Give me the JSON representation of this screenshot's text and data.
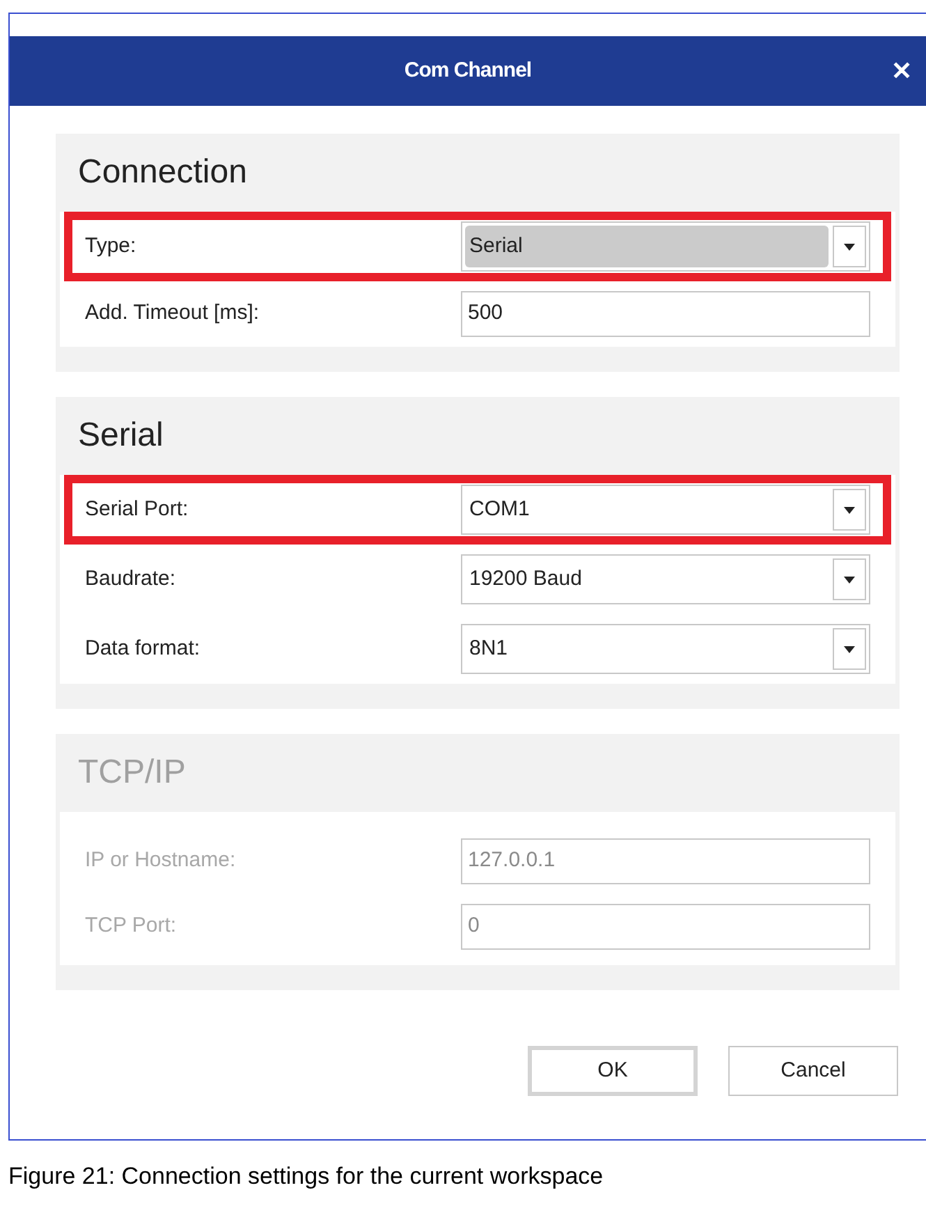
{
  "window": {
    "title": "Com Channel",
    "close": "✕"
  },
  "sections": [
    {
      "title": "Connection",
      "disabled": false,
      "fields": [
        {
          "kind": "combo",
          "label": "Type:",
          "value": "Serial",
          "disabled": true,
          "highlighted": true
        },
        {
          "kind": "text",
          "label": "Add. Timeout [ms]:",
          "value": "500",
          "disabled": false,
          "highlighted": false
        }
      ]
    },
    {
      "title": "Serial",
      "disabled": false,
      "fields": [
        {
          "kind": "combo",
          "label": "Serial Port:",
          "value": "COM1",
          "disabled": false,
          "highlighted": true
        },
        {
          "kind": "combo",
          "label": "Baudrate:",
          "value": "19200 Baud",
          "disabled": false,
          "highlighted": false
        },
        {
          "kind": "combo",
          "label": "Data format:",
          "value": "8N1",
          "disabled": false,
          "highlighted": false
        }
      ]
    },
    {
      "title": "TCP/IP",
      "disabled": true,
      "fields": [
        {
          "kind": "text",
          "label": "IP or Hostname:",
          "value": "127.0.0.1",
          "disabled": true,
          "highlighted": false
        },
        {
          "kind": "text",
          "label": "TCP Port:",
          "value": "0",
          "disabled": true,
          "highlighted": false
        }
      ]
    }
  ],
  "buttons": [
    {
      "label": "OK",
      "default": true
    },
    {
      "label": "Cancel",
      "default": false
    }
  ],
  "caption": "Figure 21: Connection settings for the current workspace"
}
